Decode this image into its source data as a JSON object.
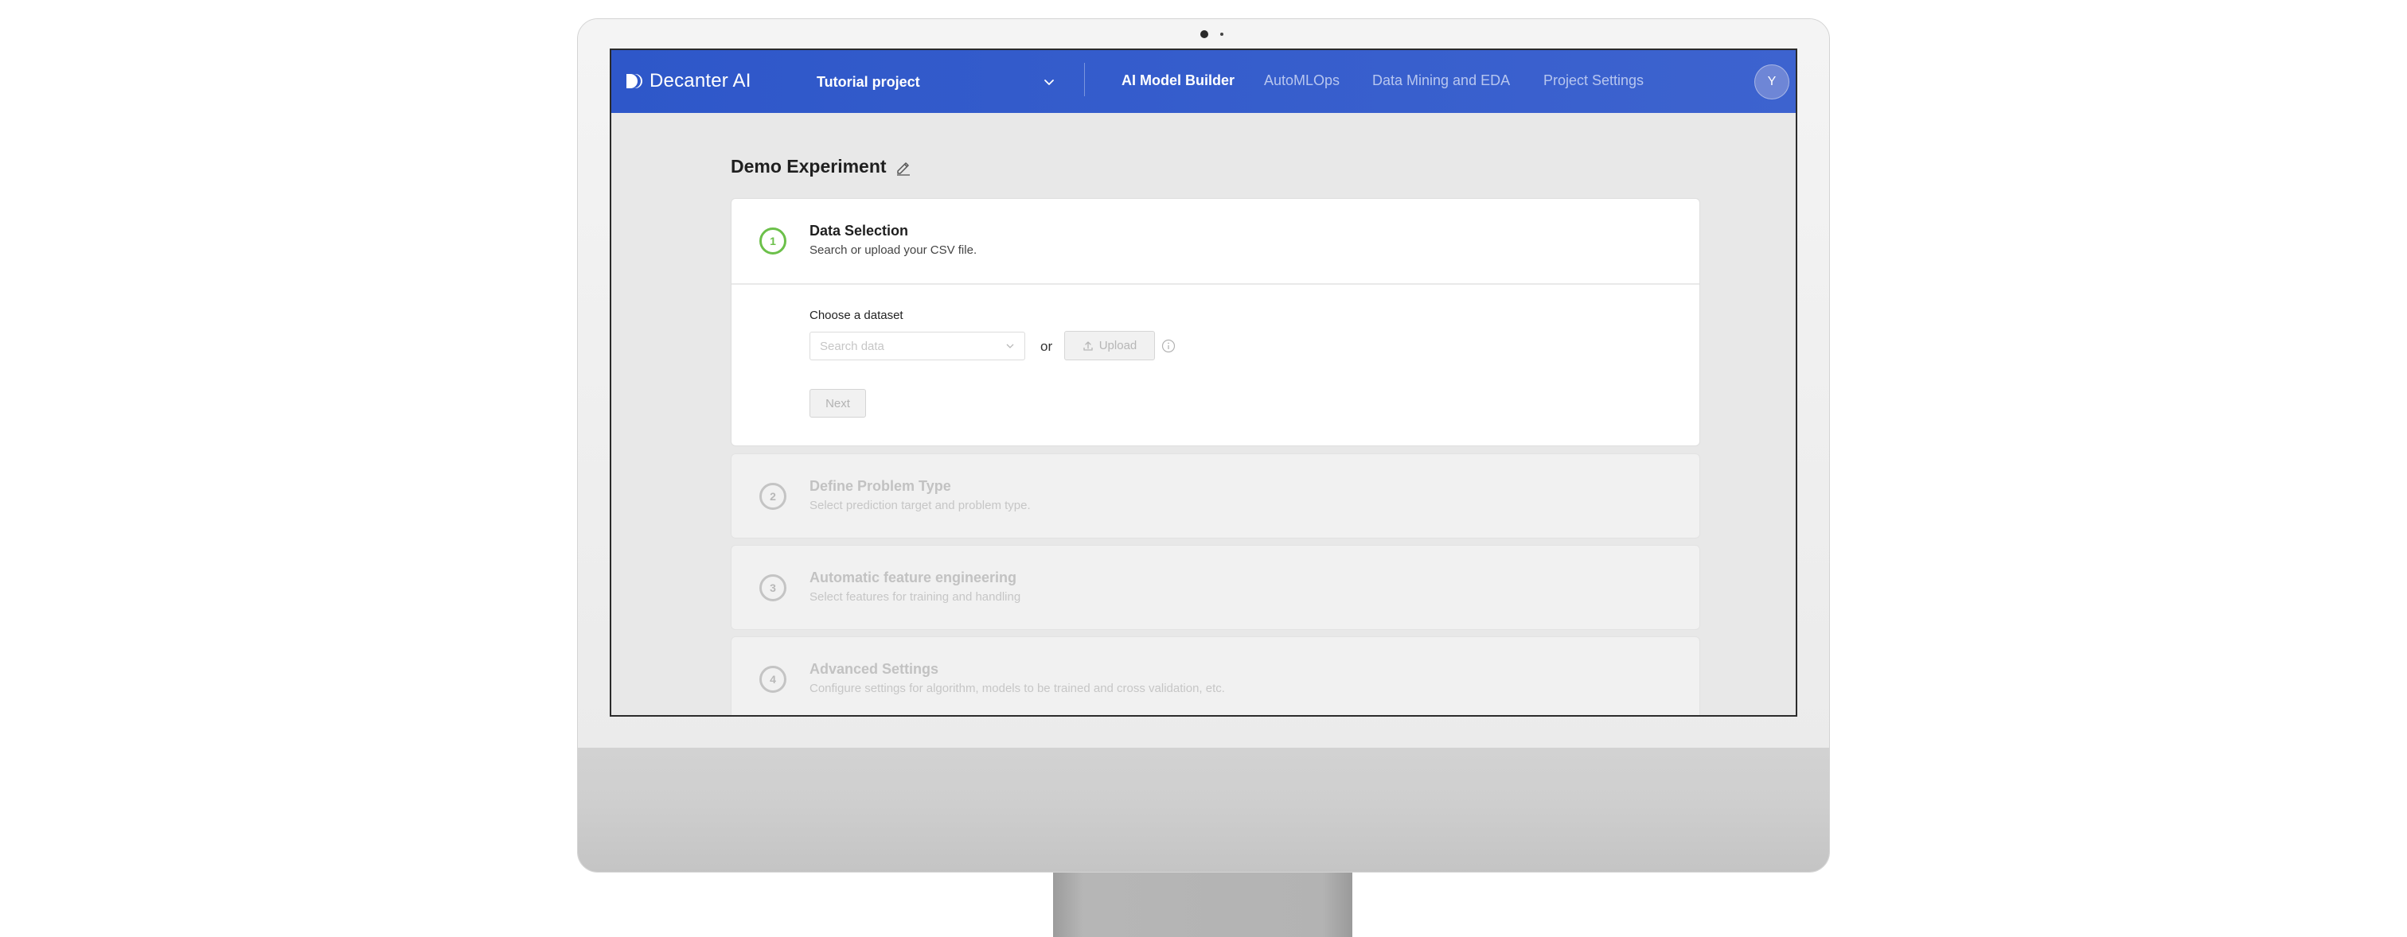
{
  "app": {
    "logo_text": "Decanter AI",
    "project": "Tutorial project",
    "avatar_initial": "Y"
  },
  "nav": {
    "items": [
      {
        "label": "AI Model Builder",
        "active": true
      },
      {
        "label": "AutoMLOps",
        "active": false
      },
      {
        "label": "Data Mining and EDA",
        "active": false
      },
      {
        "label": "Project Settings",
        "active": false
      }
    ]
  },
  "experiment": {
    "title": "Demo Experiment"
  },
  "steps": [
    {
      "number": "1",
      "title": "Data Selection",
      "description": "Search or upload your CSV file.",
      "state": "active"
    },
    {
      "number": "2",
      "title": "Define Problem Type",
      "description": "Select prediction target and problem type.",
      "state": "disabled"
    },
    {
      "number": "3",
      "title": "Automatic feature engineering",
      "description": "Select features for training and handling",
      "state": "disabled"
    },
    {
      "number": "4",
      "title": "Advanced Settings",
      "description": "Configure settings for algorithm, models to be trained and cross validation, etc.",
      "state": "disabled"
    }
  ],
  "data_selection": {
    "choose_label": "Choose a dataset",
    "search_placeholder": "Search data",
    "or_text": "or",
    "upload_label": "Upload",
    "next_label": "Next"
  },
  "colors": {
    "header": "#3459cb",
    "step_active": "#6cc04a",
    "step_inactive": "#c4c4c4"
  },
  "icons": {
    "logo": "decanter-logo-icon",
    "project_dropdown": "chevron-down-icon",
    "edit": "pencil-icon",
    "search_dropdown": "chevron-down-icon",
    "upload": "upload-icon",
    "info": "info-icon"
  }
}
